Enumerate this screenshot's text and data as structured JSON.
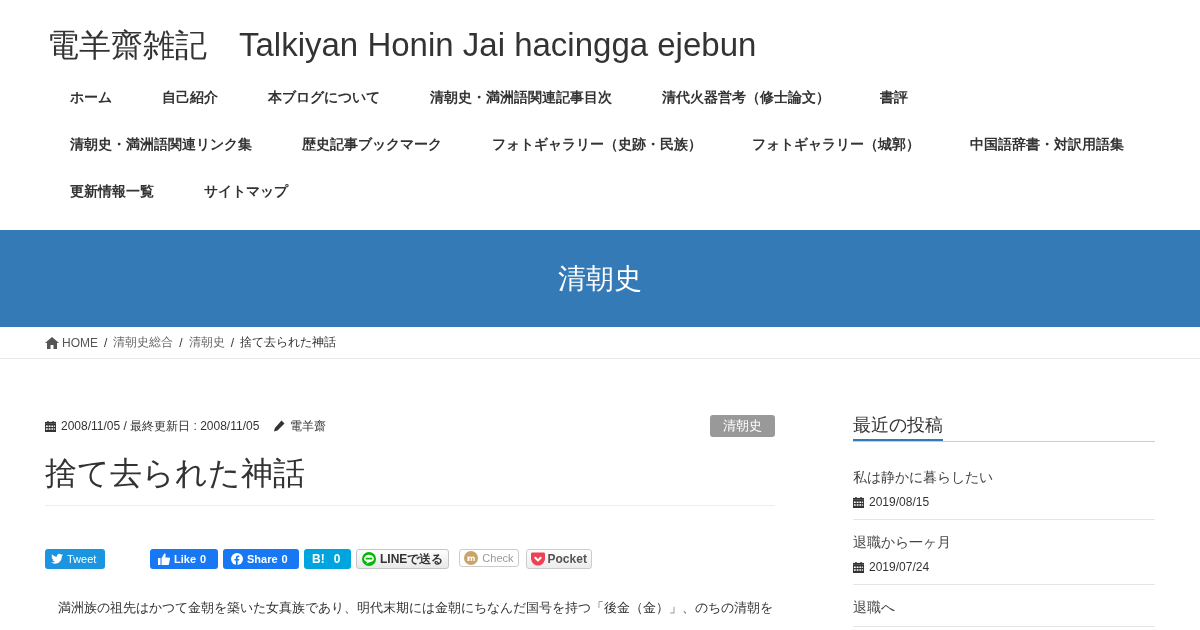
{
  "site": {
    "title": "電羊齋雑記",
    "subtitle": "Talkiyan Honin Jai hacingga ejebun"
  },
  "nav": {
    "items": [
      "ホーム",
      "自己紹介",
      "本ブログについて",
      "清朝史・満洲語関連記事目次",
      "清代火器営考（修士論文）",
      "書評",
      "清朝史・満洲語関連リンク集",
      "歴史記事ブックマーク",
      "フォトギャラリー（史跡・民族）",
      "フォトギャラリー（城郭）",
      "中国語辞書・対訳用語集",
      "更新情報一覧",
      "サイトマップ"
    ]
  },
  "page_header": {
    "title": "清朝史"
  },
  "breadcrumb": {
    "separator": "/",
    "items": [
      {
        "kind": "home",
        "label": "HOME"
      },
      {
        "kind": "link",
        "label": "清朝史総合"
      },
      {
        "kind": "link",
        "label": "清朝史"
      },
      {
        "kind": "current",
        "label": "捨て去られた神話"
      }
    ]
  },
  "post": {
    "date_line": "2008/11/05 / 最終更新日 : 2008/11/05",
    "author": "電羊齋",
    "category": "清朝史",
    "title": "捨て去られた神話",
    "share_buttons": [
      {
        "kind": "twitter",
        "label": "Tweet"
      },
      {
        "kind": "like",
        "label": "Like",
        "count": "0"
      },
      {
        "kind": "share",
        "label": "Share",
        "count": "0"
      },
      {
        "kind": "hatena",
        "label": "B!",
        "count": "0"
      },
      {
        "kind": "line",
        "label": "LINEで送る"
      },
      {
        "kind": "check",
        "label": "Check"
      },
      {
        "kind": "pocket",
        "label": "Pocket"
      }
    ],
    "body": "満洲族の祖先はかつて金朝を築いた女真族であり、明代末期には金朝にちなんだ国号を持つ「後金（金）」、のちの清朝を"
  },
  "sidebar": {
    "title": "最近の投稿",
    "posts": [
      {
        "title": "私は静かに暮らしたい",
        "date": "2019/08/15"
      },
      {
        "title": "退職から一ヶ月",
        "date": "2019/07/24"
      },
      {
        "title": "退職へ"
      }
    ]
  }
}
